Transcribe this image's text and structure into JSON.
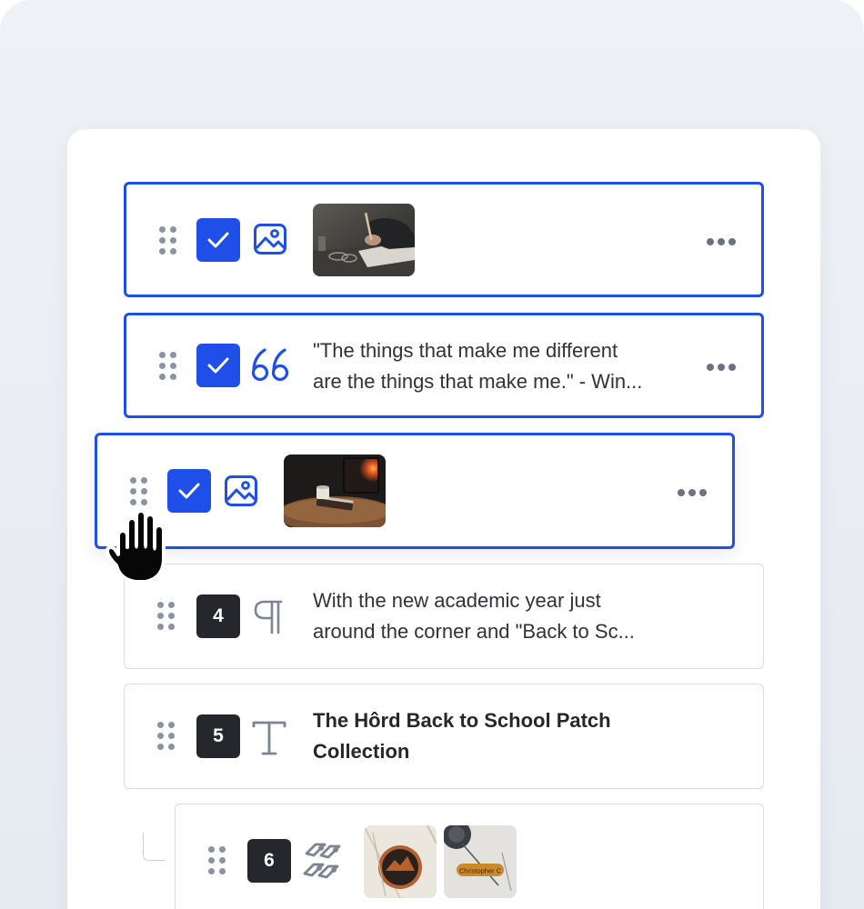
{
  "colors": {
    "accent": "#1f4fe8",
    "selected_border": "#1e4fe6",
    "neutral_border": "#d6dde6",
    "number_badge": "#25272d"
  },
  "rows": [
    {
      "index": "1",
      "type": "image",
      "selected": true,
      "icon": "image-icon",
      "thumbnail": "writing-desk-photo"
    },
    {
      "index": "2",
      "type": "quote",
      "selected": true,
      "icon": "quote-icon",
      "lines": [
        "\"The things that make me different",
        "are the things that make me.\" - Win..."
      ]
    },
    {
      "index": "3",
      "type": "image",
      "selected": true,
      "dragging": true,
      "icon": "image-icon",
      "thumbnail": "fireplace-book-photo"
    },
    {
      "index": "4",
      "type": "paragraph",
      "selected": false,
      "icon": "paragraph-icon",
      "lines": [
        "With the new academic year just",
        "around the corner and \"Back to Sc..."
      ]
    },
    {
      "index": "5",
      "type": "heading",
      "selected": false,
      "icon": "text-icon",
      "lines": [
        "The Hôrd Back to School Patch",
        "Collection"
      ]
    },
    {
      "index": "6",
      "type": "product-links",
      "selected": false,
      "nested": true,
      "icon": "link-tags-icon",
      "thumbnails": [
        "leather-patch-photo",
        "name-tag-patch-photo"
      ],
      "thumbnail_text": "Christopher C"
    }
  ],
  "cursor": "grab-hand-icon"
}
